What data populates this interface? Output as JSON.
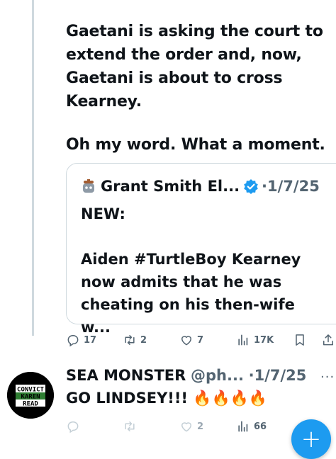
{
  "main_tweet": {
    "paragraphs": [
      "Gaetani is asking the court to extend the order and, now, Gaetani is about to cross Kearney.",
      "Oh my word. What a moment."
    ]
  },
  "quote": {
    "author": "Grant Smith El...",
    "date": "·1/7/25",
    "paragraphs": [
      "NEW:",
      "Aiden #TurtleBoy Kearney now admits that he was cheating on his then-wife w..."
    ]
  },
  "actions": {
    "replies": "17",
    "reposts": "2",
    "likes": "7",
    "views": "17K"
  },
  "reply": {
    "author": "SEA MONSTER",
    "handle": "@ph...",
    "date": "·1/7/25",
    "more": "···",
    "text": "GO LINDSEY!!! 🔥🔥🔥🔥",
    "avatar_lines": [
      "CONVICT",
      "KAREN",
      "READ"
    ],
    "likes": "2",
    "views": "66"
  },
  "fab": {
    "label": "+"
  },
  "colors": {
    "accent": "#1d9bf0",
    "muted": "#536471",
    "text": "#0f1419",
    "border": "#cfd9de",
    "verified": "#1d9bf0",
    "avatar_green": "#2e7d32"
  },
  "icons": [
    "reply-icon",
    "repost-icon",
    "like-icon",
    "views-icon",
    "bookmark-icon",
    "share-icon",
    "verified-icon",
    "bot-avatar-icon"
  ]
}
